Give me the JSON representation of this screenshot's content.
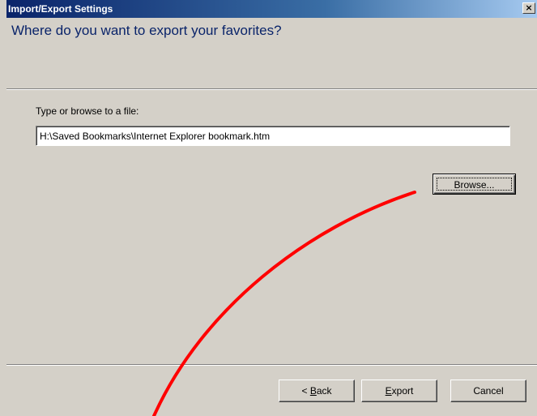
{
  "window": {
    "title": "Import/Export Settings",
    "close_label": "×"
  },
  "header": {
    "heading": "Where do you want to export your favorites?"
  },
  "form": {
    "prompt": "Type or browse to a file:",
    "file_path": "H:\\Saved Bookmarks\\Internet Explorer bookmark.htm"
  },
  "buttons": {
    "browse": "Browse...",
    "back_prefix": "< ",
    "back_accel": "B",
    "back_rest": "ack",
    "export_accel": "E",
    "export_rest": "xport",
    "cancel": "Cancel"
  },
  "annotation": {
    "color": "#ff0000"
  }
}
